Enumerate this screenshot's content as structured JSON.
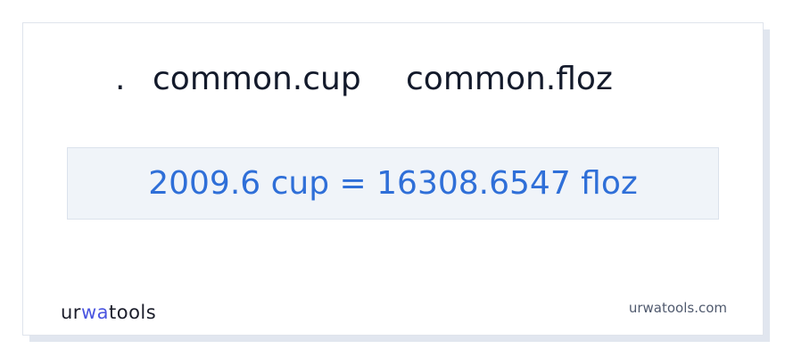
{
  "heading": {
    "dot": ".",
    "from_unit": "common.cup",
    "to_unit": "common.floz"
  },
  "result": {
    "text": "2009.6 cup = 16308.6547 floz"
  },
  "footer": {
    "logo": {
      "part1": "ur",
      "part2": "wa",
      "part3": "tools"
    },
    "site": "urwatools.com"
  },
  "colors": {
    "heading": "#131a2b",
    "result": "#2f6fd8",
    "result_background": "#f0f4f9",
    "logo_accent": "#4a55e0",
    "site_text": "#505a6e"
  }
}
